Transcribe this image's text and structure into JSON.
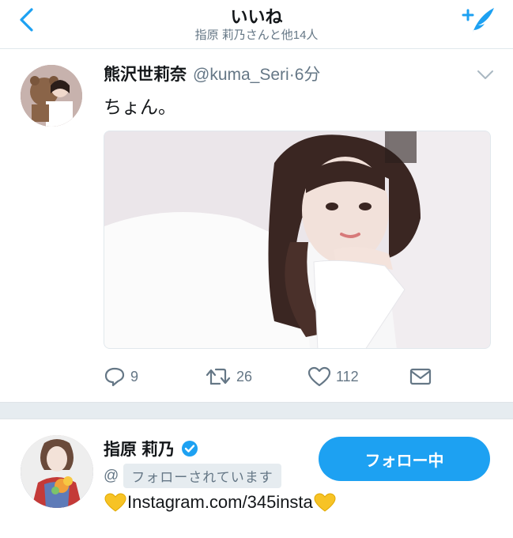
{
  "header": {
    "title": "いいね",
    "subtitle": "指原 莉乃さんと他14人"
  },
  "tweet": {
    "display_name": "熊沢世莉奈",
    "handle": "@kuma_Seri",
    "separator": "·",
    "time": "6分",
    "text": "ちょん。",
    "reply_count": "9",
    "retweet_count": "26",
    "like_count": "112"
  },
  "user": {
    "display_name": "指原 莉乃",
    "at": "@",
    "follows_you": "フォローされています",
    "follow_button": "フォロー中",
    "bio": "Instagram.com/345insta"
  },
  "colors": {
    "accent": "#1da1f2",
    "secondary_text": "#657786",
    "separator": "#e6ecf0",
    "heart_emoji": "#f7c325"
  },
  "icons": [
    "back-chevron-icon",
    "compose-quill-icon",
    "caret-down-icon",
    "reply-icon",
    "retweet-icon",
    "like-icon",
    "message-icon",
    "verified-badge-icon",
    "yellow-heart-emoji"
  ]
}
